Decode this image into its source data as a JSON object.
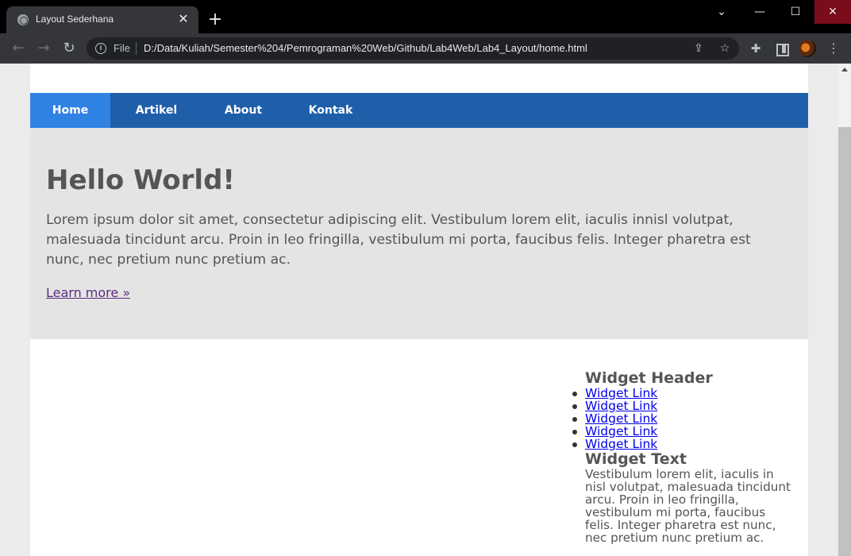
{
  "browser": {
    "tab_title": "Layout Sederhana",
    "url_scheme": "File",
    "url": "D:/Data/Kuliah/Semester%204/Pemrograman%20Web/Github/Lab4Web/Lab4_Layout/home.html"
  },
  "page": {
    "nav": [
      {
        "label": "Home",
        "active": true
      },
      {
        "label": "Artikel"
      },
      {
        "label": "About"
      },
      {
        "label": "Kontak"
      }
    ],
    "hero": {
      "title": "Hello World!",
      "text": "Lorem ipsum dolor sit amet, consectetur adipiscing elit. Vestibulum lorem elit, iaculis innisl volutpat, malesuada tincidunt arcu. Proin in leo fringilla, vestibulum mi porta, faucibus felis. Integer pharetra est nunc, nec pretium nunc pretium ac.",
      "link": "Learn more »"
    },
    "sidebar": {
      "widget_header": "Widget Header",
      "links": [
        "Widget Link",
        "Widget Link",
        "Widget Link",
        "Widget Link",
        "Widget Link"
      ],
      "widget_text_title": "Widget Text",
      "widget_text": "Vestibulum lorem elit, iaculis in nisl volutpat, malesuada tincidunt arcu. Proin in leo fringilla, vestibulum mi porta, faucibus felis. Integer pharetra est nunc, nec pretium nunc pretium ac."
    }
  },
  "colors": {
    "navbar": "#1f5faa",
    "nav_active": "#3082e3",
    "hero_bg": "#e4e4e4",
    "text": "#555555",
    "link": "#0000ee"
  },
  "icons": [
    "globe-icon",
    "close-icon",
    "plus-icon",
    "chevron-down-icon",
    "minimize-icon",
    "maximize-icon",
    "back-icon",
    "forward-icon",
    "reload-icon",
    "info-icon",
    "share-icon",
    "star-icon",
    "extensions-icon",
    "side-panel-icon",
    "menu-icon"
  ]
}
